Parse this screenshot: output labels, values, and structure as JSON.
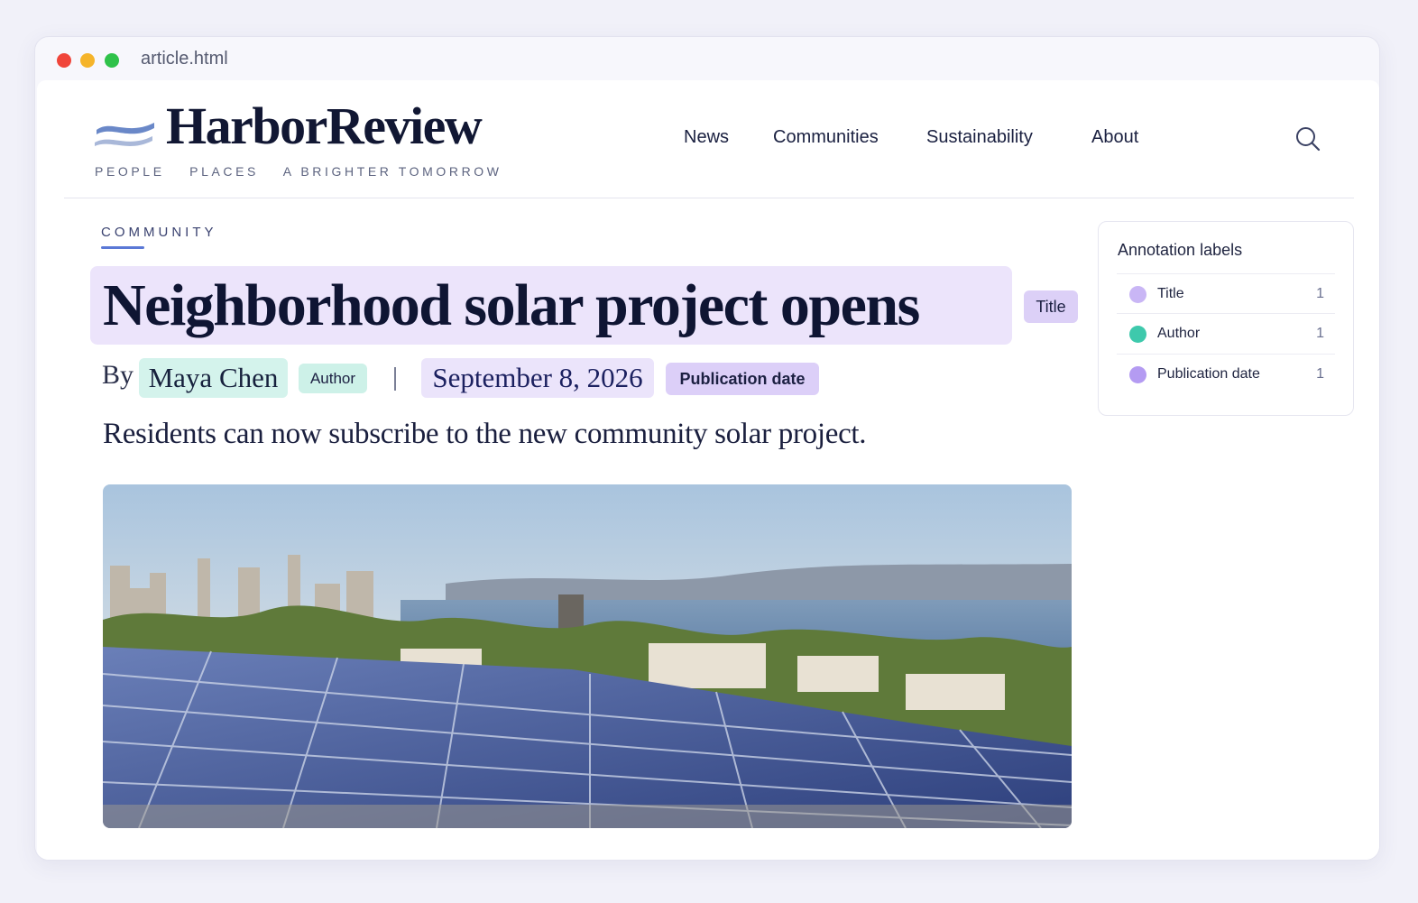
{
  "window": {
    "tab_title": "article.html"
  },
  "header": {
    "logo": "HarborReview",
    "tagline": [
      "PEOPLE",
      "PLACES",
      "A BRIGHTER TOMORROW"
    ],
    "nav": [
      "News",
      "Communities",
      "Sustainability",
      "About"
    ],
    "search_icon": "search-icon"
  },
  "article": {
    "kicker": "COMMUNITY",
    "title": "Neighborhood solar project opens",
    "title_badge": "Title",
    "by": "By",
    "author": "Maya Chen",
    "author_badge": "Author",
    "date": "September 8, 2026",
    "date_badge": "Publication date",
    "dek": "Residents can now subscribe to the new community solar project.",
    "hero_image": "Solar panels on a rooftop overlooking a city and bay"
  },
  "annotations": {
    "title": "Annotation labels",
    "items": [
      {
        "label": "Title",
        "count": "1",
        "color": "#c9b6f5"
      },
      {
        "label": "Author",
        "count": "1",
        "color": "#3ec9ac"
      },
      {
        "label": "Publication date",
        "count": "1",
        "color": "#b49bf2"
      }
    ]
  },
  "colors": {
    "title_highlight": "#ece4fb",
    "author_highlight": "#d4f3ec",
    "date_highlight": "#ebe4fb",
    "accent": "#5a78d6"
  }
}
